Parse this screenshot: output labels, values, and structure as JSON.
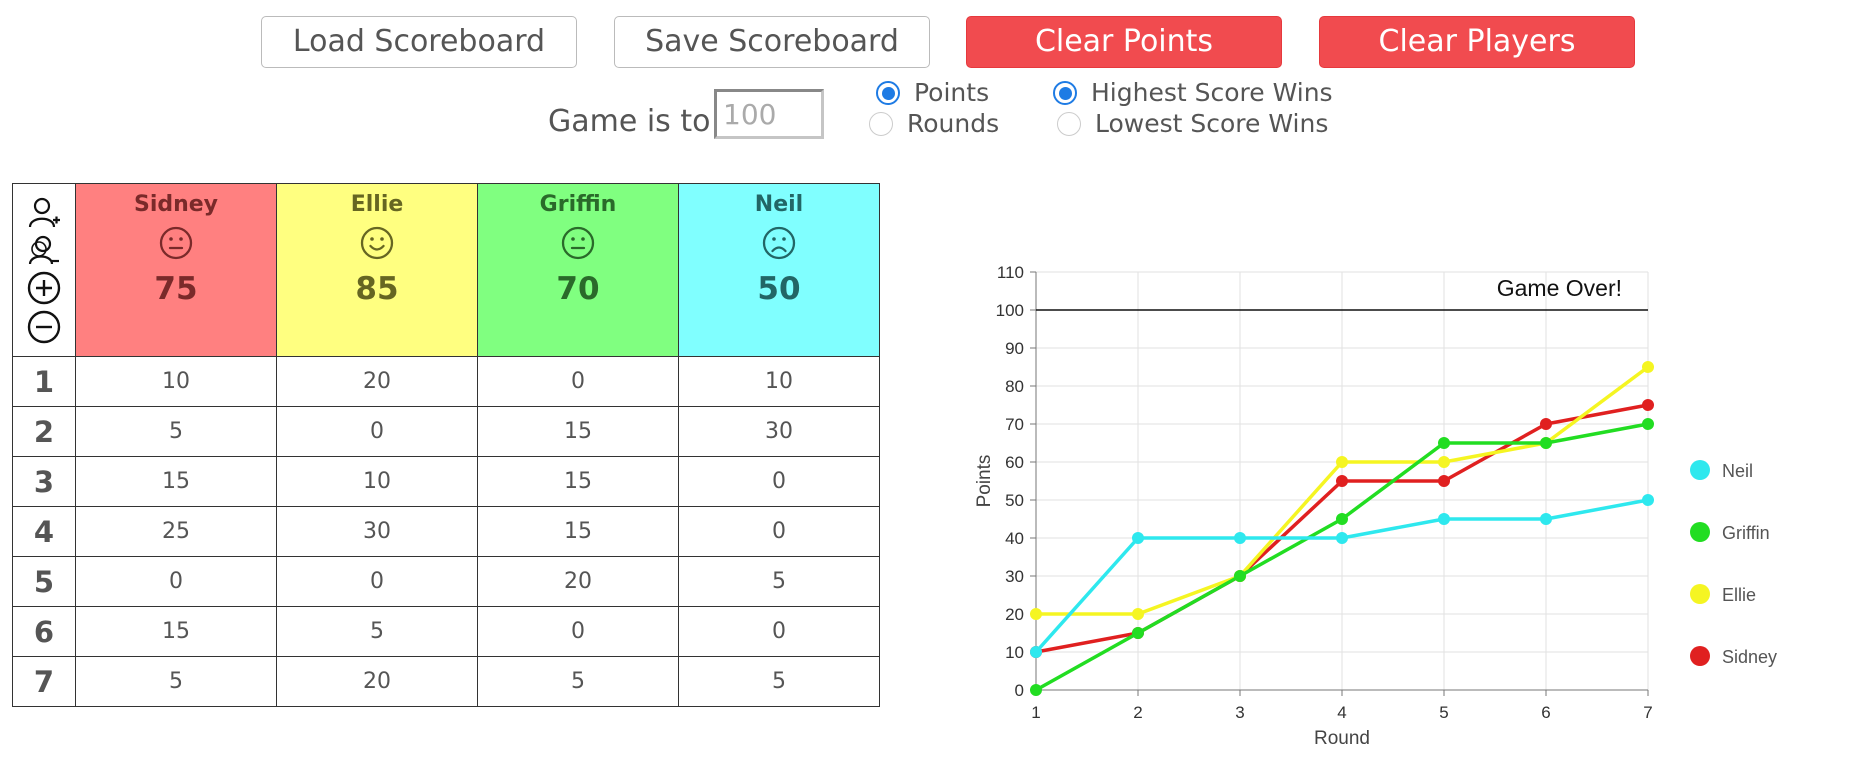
{
  "buttons": {
    "load": "Load Scoreboard",
    "save": "Save Scoreboard",
    "clear_points": "Clear Points",
    "clear_players": "Clear Players"
  },
  "settings": {
    "game_to_label": "Game is to:",
    "game_to_value": "100",
    "mode_options": [
      {
        "label": "Points",
        "checked": true
      },
      {
        "label": "Rounds",
        "checked": false
      }
    ],
    "win_options": [
      {
        "label": "Highest Score Wins",
        "checked": true
      },
      {
        "label": "Lowest Score Wins",
        "checked": false
      }
    ]
  },
  "icons": [
    "add-player-icon",
    "remove-player-icon",
    "add-round-icon",
    "remove-round-icon"
  ],
  "players": [
    {
      "name": "Sidney",
      "score": "75",
      "face": "neutral",
      "color": "#ff8080",
      "text_color": "#7a2a2a"
    },
    {
      "name": "Ellie",
      "score": "85",
      "face": "smile",
      "color": "#ffff80",
      "text_color": "#666622"
    },
    {
      "name": "Griffin",
      "score": "70",
      "face": "neutral",
      "color": "#80ff80",
      "text_color": "#2a6a2a"
    },
    {
      "name": "Neil",
      "score": "50",
      "face": "frown",
      "color": "#80ffff",
      "text_color": "#226666"
    }
  ],
  "rounds": [
    {
      "round": "1",
      "points": [
        "10",
        "20",
        "0",
        "10"
      ]
    },
    {
      "round": "2",
      "points": [
        "5",
        "0",
        "15",
        "30"
      ]
    },
    {
      "round": "3",
      "points": [
        "15",
        "10",
        "15",
        "0"
      ]
    },
    {
      "round": "4",
      "points": [
        "25",
        "30",
        "15",
        "0"
      ]
    },
    {
      "round": "5",
      "points": [
        "0",
        "0",
        "20",
        "5"
      ]
    },
    {
      "round": "6",
      "points": [
        "15",
        "5",
        "0",
        "0"
      ]
    },
    {
      "round": "7",
      "points": [
        "5",
        "20",
        "5",
        "5"
      ]
    }
  ],
  "chart_data": {
    "type": "line",
    "xlabel": "Round",
    "ylabel": "Points",
    "x": [
      1,
      2,
      3,
      4,
      5,
      6,
      7
    ],
    "ylim": [
      0,
      110
    ],
    "yticks": [
      0,
      10,
      20,
      30,
      40,
      50,
      60,
      70,
      80,
      90,
      100,
      110
    ],
    "grid": true,
    "target_line": {
      "value": 100,
      "label": "Game Over!"
    },
    "legend_position": "right",
    "series": [
      {
        "name": "Neil",
        "color": "#2ee8ee",
        "values": [
          10,
          40,
          40,
          40,
          45,
          45,
          50
        ]
      },
      {
        "name": "Griffin",
        "color": "#22dd22",
        "values": [
          0,
          15,
          30,
          45,
          65,
          65,
          70
        ]
      },
      {
        "name": "Ellie",
        "color": "#f5f522",
        "values": [
          20,
          20,
          30,
          60,
          60,
          65,
          85
        ]
      },
      {
        "name": "Sidney",
        "color": "#e02020",
        "values": [
          10,
          15,
          30,
          55,
          55,
          70,
          75
        ]
      }
    ]
  }
}
